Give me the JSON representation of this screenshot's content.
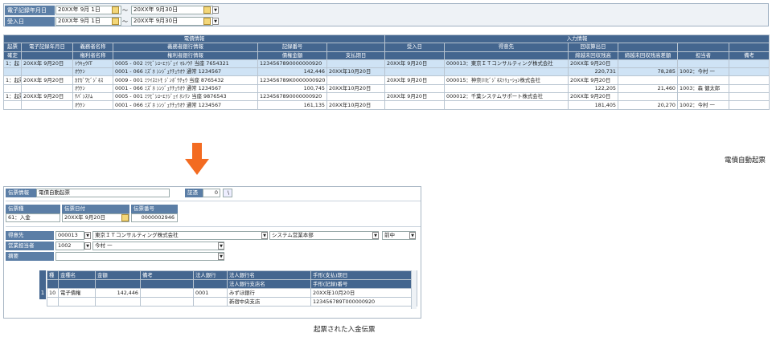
{
  "filter": {
    "date_label": "電子記録年月日",
    "recv_label": "受入日",
    "date_from": "20XX年 9月 1日",
    "date_to": "20XX年 9月30日",
    "recv_from": "20XX年 9月 1日",
    "recv_to": "20XX年 9月30日",
    "tilde": "～"
  },
  "grid": {
    "group1": "電債情報",
    "group2": "入力情報",
    "h1": [
      "起票",
      "電子記録年月日",
      "義務者名称",
      "義務者銀行情報",
      "記録番号",
      "",
      "受入日",
      "得意先",
      "回収算出日",
      "",
      "",
      ""
    ],
    "h2": [
      "確定",
      "",
      "権利者名称",
      "権利者銀行情報",
      "債権金額",
      "支払期日",
      "",
      "",
      "締越未回収残高",
      "締越未回収残高差額",
      "担当者",
      "備考"
    ],
    "rows": [
      {
        "c": [
          "1：起",
          "20XX年 9月20日",
          "ﾄｳｷｮｳIT",
          "0005 - 002 ﾐﾂﾋﾞｼﾕｰｴﾌｼﾞｪｲ ﾏﾙﾉｳﾁ 当座 7654321",
          "1234567890000000920",
          "",
          "20XX年 9月20日",
          "000013：東京ＩＴコンサルティング株式会社",
          "20XX年 9月20日",
          "",
          "",
          ""
        ],
        "sel": true,
        "dd": true
      },
      {
        "c": [
          "",
          "",
          "ｵｳｹﾝ",
          "0001 - 066 ﾐｽﾞﾎ ｼﾝｼﾞｭｸﾁｭｳｵｳ 通常 1234567",
          "142,446",
          "20XX年10月20日",
          "",
          "",
          "220,731",
          "78,285",
          "1002：今村 一",
          ""
        ],
        "sel": true
      },
      {
        "c": [
          "1：起票",
          "20XX年 9月20日",
          "ｶﾅｶﾞﾜﾋﾞｼﾞﾈｽ",
          "0009 - 001 ﾐﾂｲｽﾐﾄﾓ ｼﾞﾝﾎﾞｳﾁｮｳ 当座 8765432",
          "123456789K0000000920",
          "",
          "20XX年 9月20日",
          "000015：神奈川ﾋﾞｼﾞﾈｽｿﾘｭｰｼｮﾝ株式会社",
          "20XX年 9月20日",
          "",
          "",
          ""
        ]
      },
      {
        "c": [
          "",
          "",
          "ｵｳｹﾝ",
          "0001 - 066 ﾐｽﾞﾎ ｼﾝｼﾞｭｸﾁｭｳｵｳ 通常 1234567",
          "100,745",
          "20XX年10月20日",
          "",
          "",
          "122,205",
          "21,460",
          "1003：森 健太郎",
          ""
        ]
      },
      {
        "c": [
          "1：起票",
          "20XX年 9月20日",
          "ﾁﾊﾞｼｽﾃﾑ",
          "0005 - 001 ﾐﾂﾋﾞｼﾕｰｴﾌｼﾞｪｲ ﾎﾝﾃﾝ 当座 9876543",
          "1234567890000000920",
          "",
          "20XX年 9月20日",
          "000012：千葉システムサポート株式会社",
          "20XX年 9月20日",
          "",
          "",
          ""
        ]
      },
      {
        "c": [
          "",
          "",
          "ｵｳｹﾝ",
          "0001 - 066 ﾐｽﾞﾎ ｼﾝｼﾞｭｸﾁｭｳｵｳ 通常 1234567",
          "161,135",
          "20XX年10月20日",
          "",
          "",
          "181,405",
          "20,270",
          "1002：今村 一",
          ""
        ]
      }
    ]
  },
  "caption1": "電債自動起票",
  "caption2": "起票された入金伝票",
  "form": {
    "slip_info_label": "伝票情報",
    "slip_info_value": "電債自動起票",
    "proof_label": "証憑",
    "proof_value": "0",
    "proof_btn": "\\",
    "kind_label": "伝票種",
    "kind_value": "61：入金",
    "date_label": "伝票日付",
    "date_value": "20XX年 9月20日",
    "no_label": "伝票番号",
    "no_value": "0000002946",
    "cust_label": "得意先",
    "cust_code": "000013",
    "cust_name": "東京ＩＴコンサルティング株式会社",
    "dept": "システム営業本部",
    "dept2": "前中",
    "staff_label": "営業担当者",
    "staff_code": "1002",
    "staff_name": "今村 一",
    "memo_label": "摘要",
    "sub_h1": [
      "種",
      "金種名",
      "金額",
      "備考",
      "法人銀行",
      "法人銀行名",
      "手形(支払)期日"
    ],
    "sub_h2": [
      "",
      "",
      "",
      "",
      "",
      "法人銀行支店名",
      "手形(記録)番号"
    ],
    "sub_r1": [
      "10",
      "電子債権",
      "142,446",
      "",
      "0001",
      "みずほ銀行",
      "20XX年10月20日"
    ],
    "sub_r2": [
      "",
      "",
      "",
      "",
      "",
      "新宿中央支店",
      "123456789T000000920"
    ],
    "row_no": "1"
  }
}
